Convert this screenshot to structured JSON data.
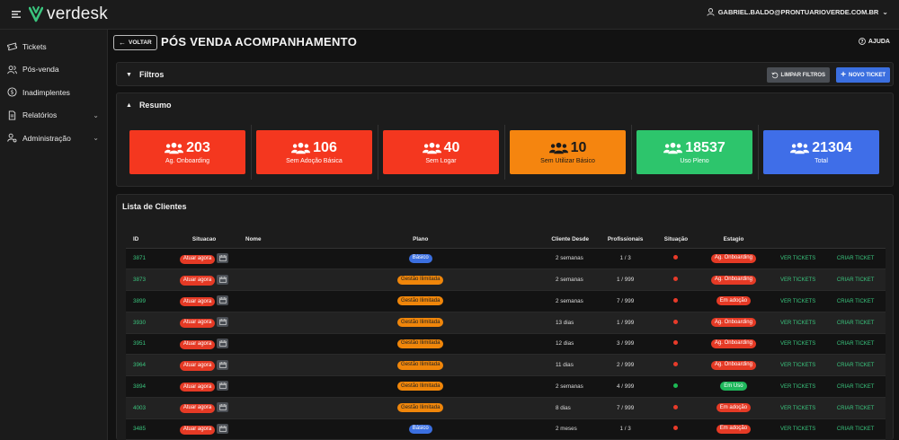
{
  "app": {
    "logo_text": "verdesk"
  },
  "user": {
    "email": "GABRIEL.BALDO@PRONTUARIOVERDE.COM.BR"
  },
  "sidebar": {
    "items": [
      {
        "label": "Tickets",
        "icon": "ticket-icon",
        "has_chevron": false
      },
      {
        "label": "Pós-venda",
        "icon": "users-icon",
        "has_chevron": false
      },
      {
        "label": "Inadimplentes",
        "icon": "dollar-icon",
        "has_chevron": false
      },
      {
        "label": "Relatórios",
        "icon": "report-icon",
        "has_chevron": true
      },
      {
        "label": "Administração",
        "icon": "user-gear-icon",
        "has_chevron": true
      }
    ]
  },
  "header": {
    "back_label": "VOLTAR",
    "title": "PÓS VENDA ACOMPANHAMENTO",
    "help_label": "AJUDA"
  },
  "filtros": {
    "title": "Filtros",
    "clear_label": "LIMPAR FILTROS",
    "new_label": "NOVO TICKET"
  },
  "resumo": {
    "title": "Resumo",
    "cards": [
      {
        "value": "203",
        "label": "Ag. Onboarding",
        "color": "#f4371f",
        "text_color": "#ffffff"
      },
      {
        "value": "106",
        "label": "Sem Adoção Básica",
        "color": "#f4371f",
        "text_color": "#ffffff"
      },
      {
        "value": "40",
        "label": "Sem Logar",
        "color": "#f4371f",
        "text_color": "#ffffff"
      },
      {
        "value": "10",
        "label": "Sem Utilizar Básico",
        "color": "#f5850f",
        "text_color": "#1a1a1a"
      },
      {
        "value": "18537",
        "label": "Uso Pleno",
        "color": "#2dc56c",
        "text_color": "#ffffff"
      },
      {
        "value": "21304",
        "label": "Total",
        "color": "#3f6ee8",
        "text_color": "#ffffff"
      }
    ]
  },
  "lista": {
    "title": "Lista de Clientes",
    "columns": [
      "ID",
      "Situacao",
      "Nome",
      "Plano",
      "Cliente Desde",
      "Profissionais",
      "Situação",
      "Estagio",
      "",
      ""
    ],
    "action_label": "Atuar agora",
    "ver_label": "VER TICKETS",
    "criar_label": "CRIAR TICKET",
    "rows": [
      {
        "id": "3871",
        "plano": "Básico",
        "plano_color": "blue",
        "desde": "2 semanas",
        "prof": "1 / 3",
        "sit": "red",
        "estagio": "Ag. Onboarding",
        "estagio_color": "red"
      },
      {
        "id": "3873",
        "plano": "Gestão Ilimitada",
        "plano_color": "orange",
        "desde": "2 semanas",
        "prof": "1 / 999",
        "sit": "red",
        "estagio": "Ag. Onboarding",
        "estagio_color": "red"
      },
      {
        "id": "3899",
        "plano": "Gestão Ilimitada",
        "plano_color": "orange",
        "desde": "2 semanas",
        "prof": "7 / 999",
        "sit": "red",
        "estagio": "Em adoção",
        "estagio_color": "red"
      },
      {
        "id": "3930",
        "plano": "Gestão Ilimitada",
        "plano_color": "orange",
        "desde": "13 dias",
        "prof": "1 / 999",
        "sit": "red",
        "estagio": "Ag. Onboarding",
        "estagio_color": "red"
      },
      {
        "id": "3951",
        "plano": "Gestão Ilimitada",
        "plano_color": "orange",
        "desde": "12 dias",
        "prof": "3 / 999",
        "sit": "red",
        "estagio": "Ag. Onboarding",
        "estagio_color": "red"
      },
      {
        "id": "3964",
        "plano": "Gestão Ilimitada",
        "plano_color": "orange",
        "desde": "11 dias",
        "prof": "2 / 999",
        "sit": "red",
        "estagio": "Ag. Onboarding",
        "estagio_color": "red"
      },
      {
        "id": "3894",
        "plano": "Gestão Ilimitada",
        "plano_color": "orange",
        "desde": "2 semanas",
        "prof": "4 / 999",
        "sit": "green",
        "estagio": "Em Uso",
        "estagio_color": "green"
      },
      {
        "id": "4003",
        "plano": "Gestão Ilimitada",
        "plano_color": "orange",
        "desde": "8 dias",
        "prof": "7 / 999",
        "sit": "red",
        "estagio": "Em adoção",
        "estagio_color": "red"
      },
      {
        "id": "3485",
        "plano": "Básico",
        "plano_color": "blue",
        "desde": "2 meses",
        "prof": "1 / 3",
        "sit": "red",
        "estagio": "Em adoção",
        "estagio_color": "red"
      }
    ]
  }
}
